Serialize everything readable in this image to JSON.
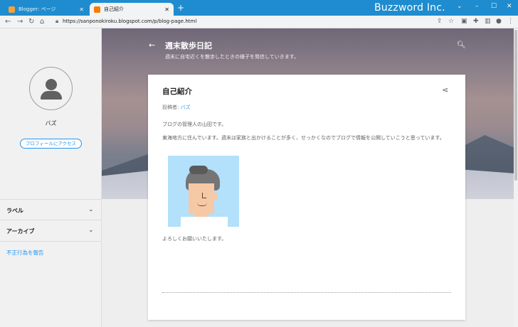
{
  "browser": {
    "tabs": [
      {
        "label": "Blogger: ページ",
        "active": false
      },
      {
        "label": "自己紹介",
        "active": true
      }
    ],
    "new_tab": "+",
    "brand": "Buzzword Inc.",
    "window_controls": {
      "dropdown": "⌄",
      "minimize": "–",
      "maximize": "☐",
      "close": "✕"
    },
    "url": "https://sanponokiroku.blogspot.com/p/blog-page.html",
    "nav": {
      "back": "←",
      "forward": "→",
      "reload": "↻",
      "home": "⌂"
    },
    "toolbar_icons": [
      "share-icon",
      "star-icon",
      "extension-icon",
      "puzzle-icon",
      "sidepanel-icon",
      "profile-icon",
      "menu-icon"
    ]
  },
  "sidebar": {
    "profile_name": "バズ",
    "profile_button": "プロフィールにアクセス",
    "sections": [
      {
        "label": "ラベル"
      },
      {
        "label": "アーカイブ"
      }
    ],
    "report_link": "不正行為を報告"
  },
  "header": {
    "title": "週末散歩日記",
    "description": "週末に自宅近くを散歩したときの様子を発信していきます。"
  },
  "post": {
    "title": "自己紹介",
    "byline_prefix": "投稿者: ",
    "author": "バズ",
    "paragraphs": [
      "ブログの管理人の山田です。",
      "東海地方に住んでいます。週末は家族と出かけることが多く、せっかくなのでブログで情報を公開していこうと思っています。",
      "よろしくお願いいたします。"
    ]
  },
  "colors": {
    "accent": "#2196f3",
    "titlebar": "#1f8ccf"
  }
}
